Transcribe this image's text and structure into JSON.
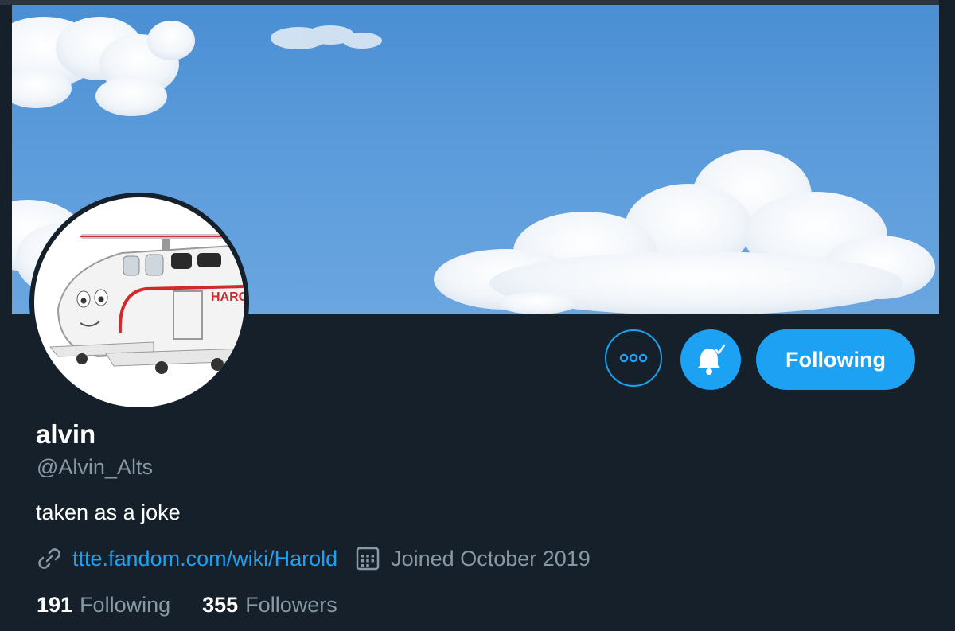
{
  "profile": {
    "name": "alvin",
    "handle": "@Alvin_Alts",
    "bio": "taken as a joke",
    "website": "ttte.fandom.com/wiki/Harold",
    "joined": "Joined October 2019",
    "avatar_caption": "HARO"
  },
  "stats": {
    "following_count": "191",
    "following_label": "Following",
    "followers_count": "355",
    "followers_label": "Followers"
  },
  "actions": {
    "more_icon": "more-icon",
    "notify_icon": "bell-check-icon",
    "follow_label": "Following"
  },
  "colors": {
    "background": "#15202b",
    "accent": "#1da1f2",
    "secondary_text": "#8899a6",
    "primary_text": "#ffffff"
  }
}
